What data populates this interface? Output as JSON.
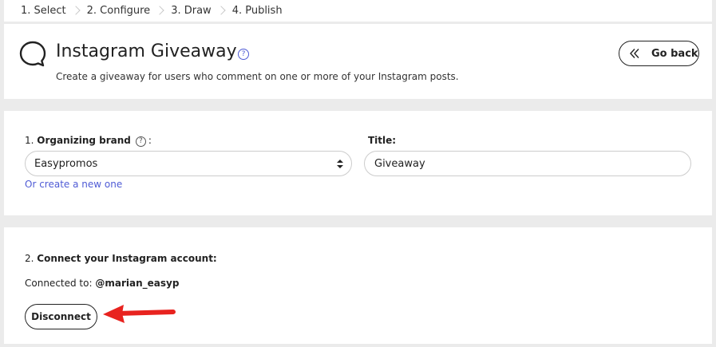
{
  "steps": [
    "1. Select",
    "2. Configure",
    "3. Draw",
    "4. Publish"
  ],
  "header": {
    "title": "Instagram Giveaway",
    "help_glyph": "?",
    "subtitle": "Create a giveaway for users who comment on one or more of your Instagram posts.",
    "go_back_label": "Go back"
  },
  "form": {
    "brand_prefix": "1. ",
    "brand_label": "Organizing brand",
    "brand_help_glyph": "?",
    "brand_suffix": ":",
    "brand_value": "Easypromos",
    "create_link": "Or create a new one",
    "title_label": "Title:",
    "title_value": "Giveaway"
  },
  "connect": {
    "prefix": "2. ",
    "label": "Connect your Instagram account:",
    "connected_prefix": "Connected to: ",
    "account": "@marian_easyp",
    "disconnect_label": "Disconnect"
  },
  "colors": {
    "accent": "#4f5bd5",
    "annotation_arrow": "#e8231f",
    "divider": "#ebebeb"
  },
  "icons": {
    "header": "speech-bubble-icon",
    "back": "double-chevron-left-icon",
    "select": "sort-arrows-icon"
  }
}
